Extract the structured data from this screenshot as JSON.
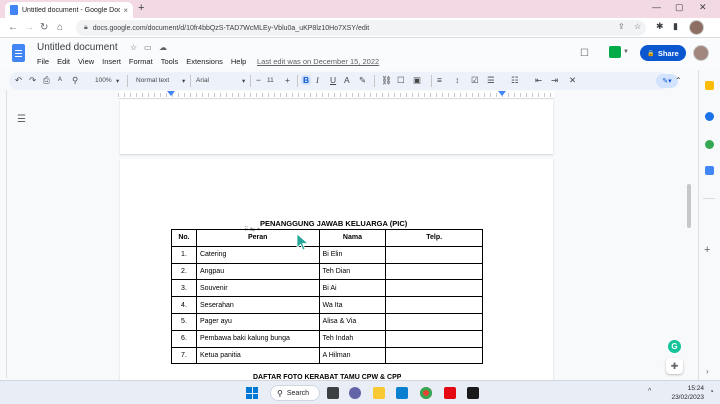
{
  "browser": {
    "tab_title": "Untitled document - Google Docs",
    "tab_close": "×",
    "new_tab": "+",
    "url": "docs.google.com/document/d/10fr4bbQzS-TAD7WcMLEy-Vblu0a_uKP8lz10Ho7XSY/edit",
    "win_minimize": "—",
    "win_maximize": "▢",
    "win_close": "✕",
    "nav_back": "←",
    "nav_forward": "→",
    "nav_reload": "↻",
    "nav_home": "⌂"
  },
  "docs": {
    "doc_title": "Untitled document",
    "menu": [
      "File",
      "Edit",
      "View",
      "Insert",
      "Format",
      "Tools",
      "Extensions",
      "Help"
    ],
    "last_edit": "Last edit was on December 15, 2022",
    "share_label": "Share",
    "share_lock": "🔒"
  },
  "toolbar": {
    "zoom": "100%",
    "style": "Normal text",
    "font": "Arial",
    "font_size": "11",
    "minus": "−",
    "plus": "+",
    "bold": "B",
    "italic": "I",
    "underline": "U"
  },
  "document": {
    "heading": "PENANGGUNG JAWAB KELUARGA (PIC)",
    "table": {
      "headers": [
        "No.",
        "Peran",
        "Nama",
        "Telp."
      ],
      "rows": [
        [
          "1.",
          "Catering",
          "Bi Elin",
          ""
        ],
        [
          "2.",
          "Angpau",
          "Teh Dian",
          ""
        ],
        [
          "3.",
          "Souvenir",
          "Bi Ai",
          ""
        ],
        [
          "4.",
          "Seserahan",
          "Wa Ita",
          ""
        ],
        [
          "5.",
          "Pager ayu",
          "Alisa & Via",
          ""
        ],
        [
          "6.",
          "Pembawa baki kalung bunga",
          "Teh Indah",
          ""
        ],
        [
          "7.",
          "Ketua panitia",
          "A Hilman",
          ""
        ]
      ]
    },
    "subheading": "DAFTAR FOTO KERABAT TAMU CPW & CPP"
  },
  "taskbar": {
    "search_label": "Search",
    "time": "15:24",
    "date": "23/02/2023"
  },
  "colors": {
    "tab_strip": "#f3d9e4",
    "share_button": "#0b57d0",
    "toolbar_bg": "#edf2fa",
    "cursor": "#26a69a"
  }
}
